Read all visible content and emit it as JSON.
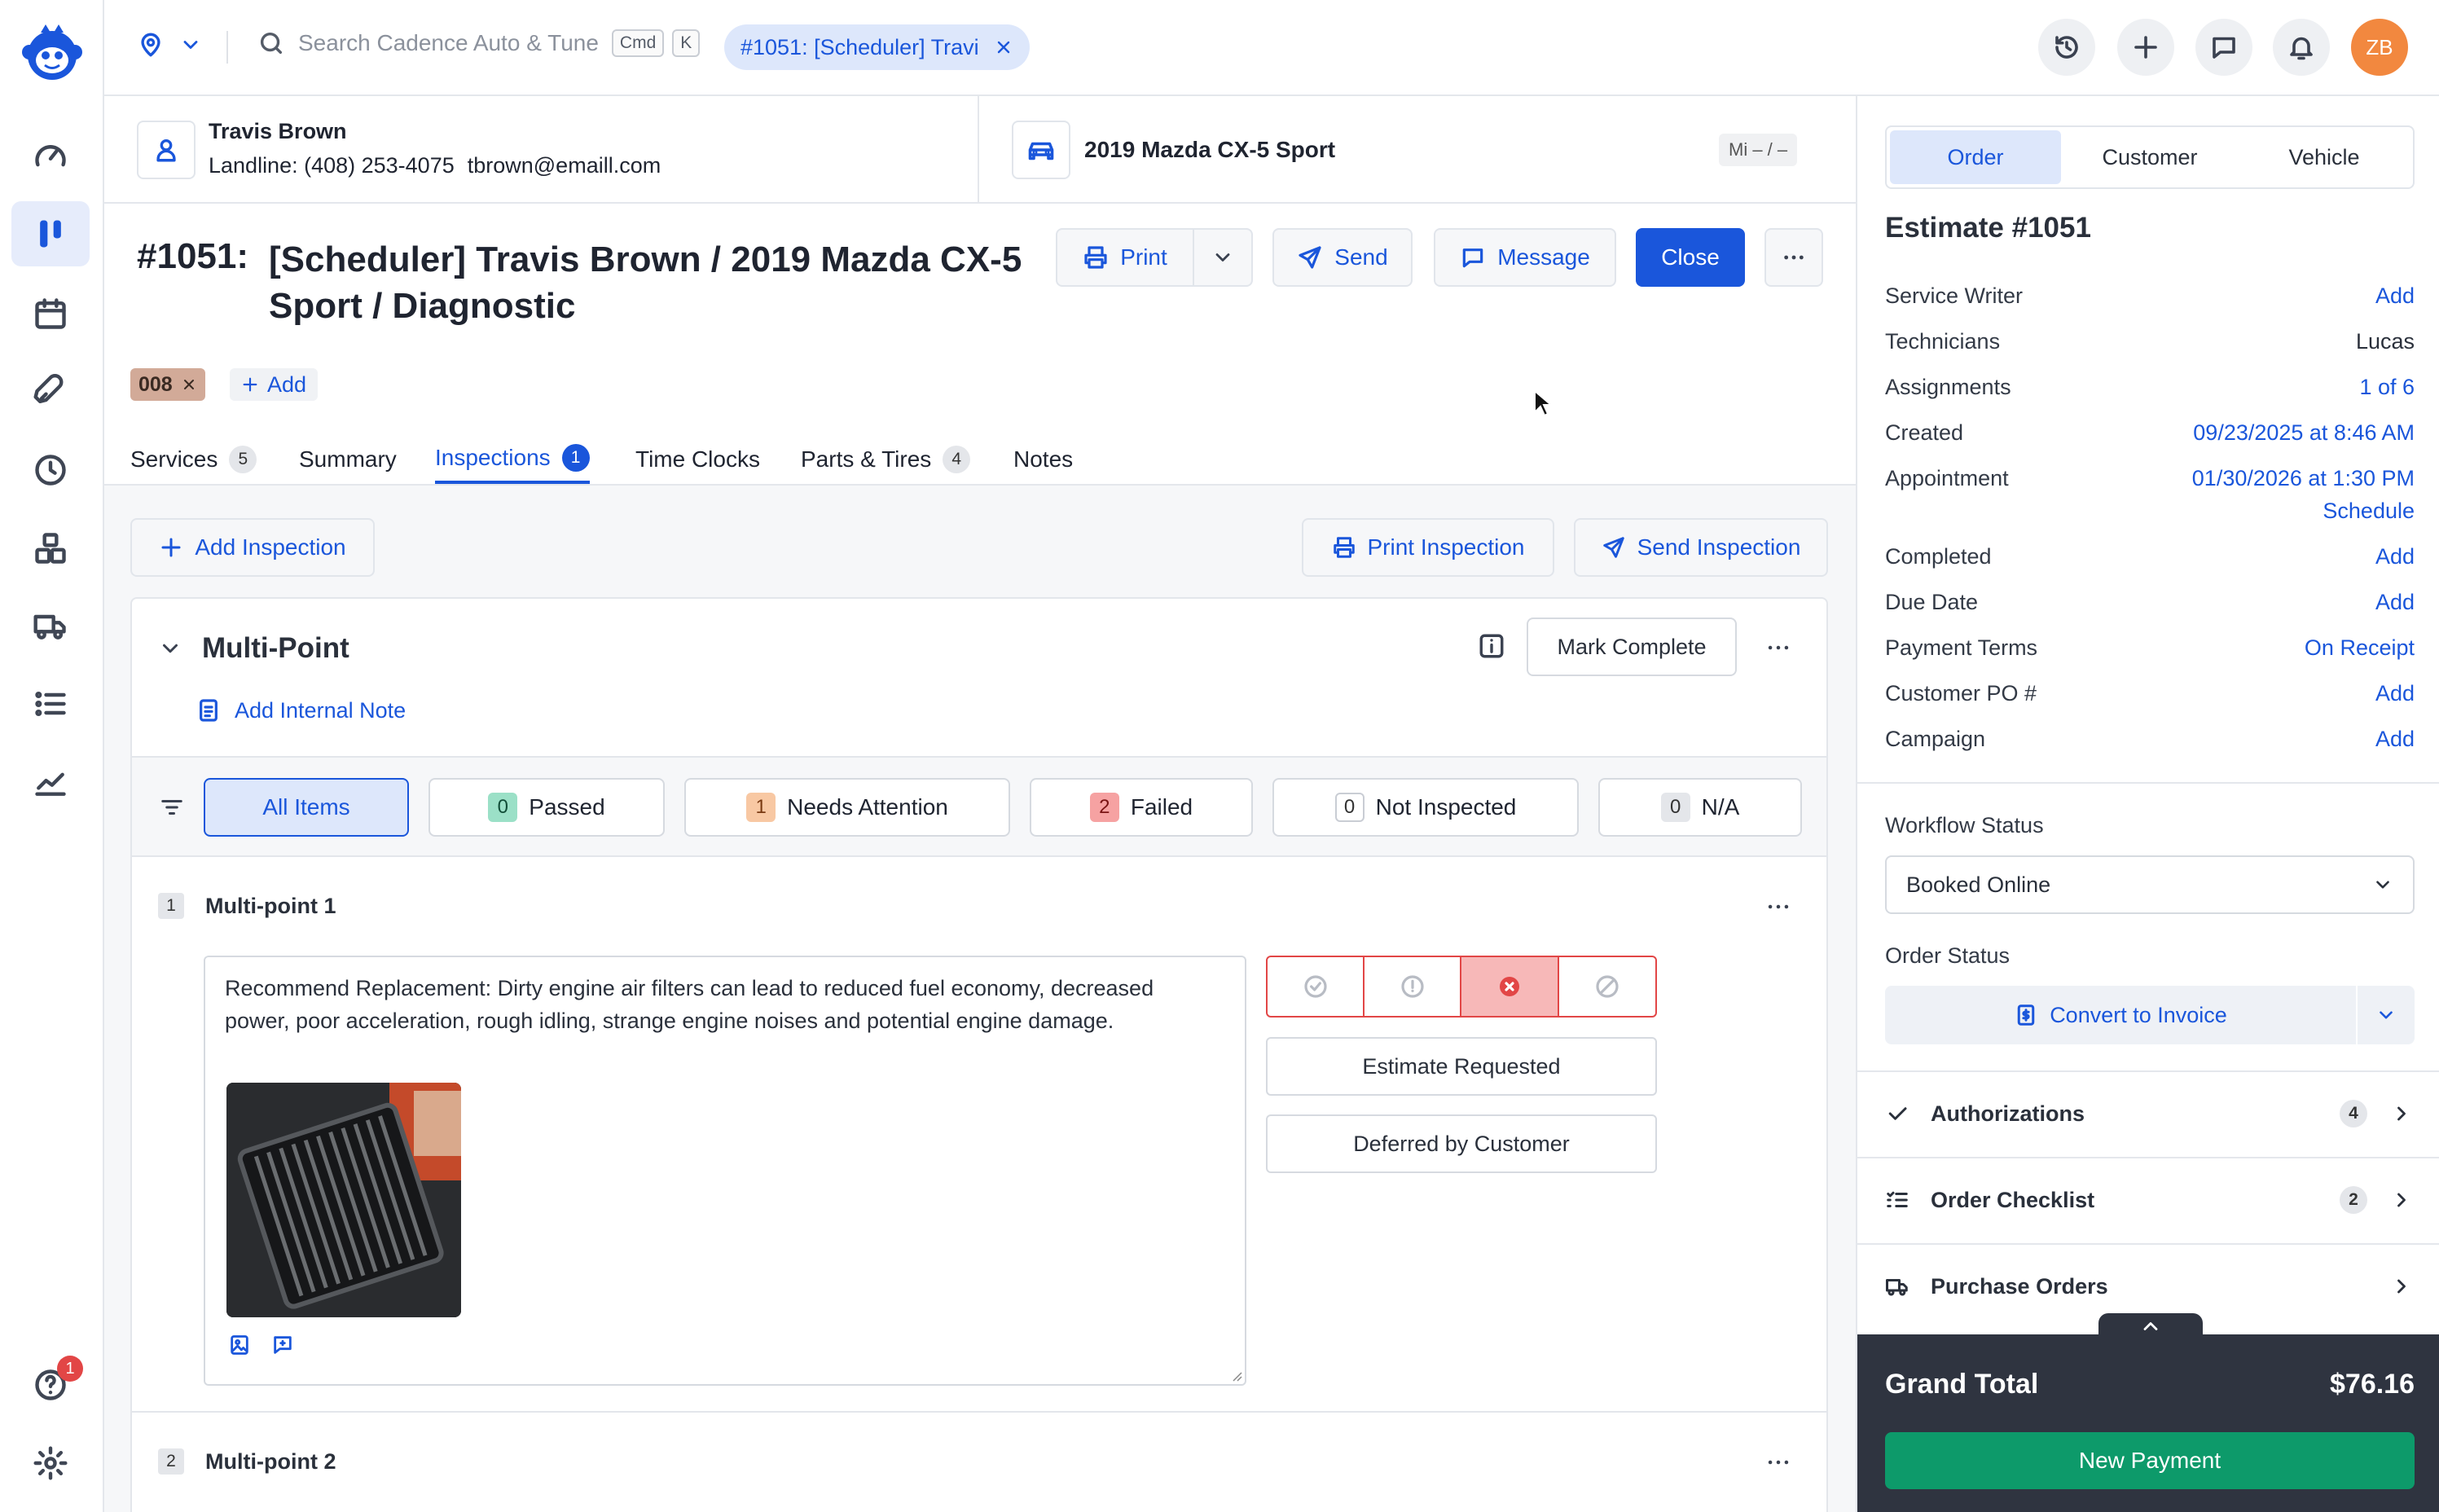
{
  "nav": {
    "help_badge": "1"
  },
  "topbar": {
    "search_placeholder": "Search Cadence Auto & Tune",
    "kbd_cmd": "Cmd",
    "kbd_k": "K",
    "open_tab": "#1051: [Scheduler] Travi",
    "avatar": "ZB"
  },
  "customer": {
    "name": "Travis Brown",
    "phone": "Landline: (408) 253-4075",
    "email": "tbrown@emaill.com"
  },
  "vehicle": {
    "name": "2019 Mazda CX-5 Sport",
    "mileage": "Mi – / –"
  },
  "order": {
    "number": "#1051:",
    "title": "[Scheduler] Travis Brown / 2019 Mazda CX-5 Sport / Diagnostic",
    "tag": "008",
    "add_tag": "Add"
  },
  "actions": {
    "print": "Print",
    "send": "Send",
    "message": "Message",
    "close": "Close"
  },
  "tabs": [
    {
      "label": "Services",
      "count": "5"
    },
    {
      "label": "Summary",
      "count": ""
    },
    {
      "label": "Inspections",
      "count": "1"
    },
    {
      "label": "Time Clocks",
      "count": ""
    },
    {
      "label": "Parts & Tires",
      "count": "4"
    },
    {
      "label": "Notes",
      "count": ""
    }
  ],
  "inspection": {
    "add_inspection": "Add Inspection",
    "print_inspection": "Print Inspection",
    "send_inspection": "Send Inspection",
    "title": "Multi-Point",
    "mark_complete": "Mark Complete",
    "add_internal_note": "Add Internal Note",
    "filters": [
      {
        "label": "All Items",
        "count": ""
      },
      {
        "label": "Passed",
        "count": "0"
      },
      {
        "label": "Needs Attention",
        "count": "1"
      },
      {
        "label": "Failed",
        "count": "2"
      },
      {
        "label": "Not Inspected",
        "count": "0"
      },
      {
        "label": "N/A",
        "count": "0"
      }
    ],
    "items": [
      {
        "index": "1",
        "name": "Multi-point 1",
        "note": "Recommend Replacement: Dirty engine air filters can lead to reduced fuel economy, decreased power, poor acceleration, rough idling, strange engine noises and potential engine damage.",
        "estimate_requested": "Estimate Requested",
        "deferred": "Deferred by Customer",
        "status": "failed"
      },
      {
        "index": "2",
        "name": "Multi-point 2"
      }
    ]
  },
  "panel": {
    "tabs": [
      "Order",
      "Customer",
      "Vehicle"
    ],
    "estimate_title": "Estimate #1051",
    "fields": [
      {
        "key": "Service Writer",
        "value": "Add"
      },
      {
        "key": "Technicians",
        "value": "Lucas"
      },
      {
        "key": "Assignments",
        "value": "1 of 6"
      },
      {
        "key": "Created",
        "value": "09/23/2025 at 8:46 AM"
      },
      {
        "key": "Appointment",
        "value": "01/30/2026 at 1:30 PM",
        "extra": "Schedule"
      },
      {
        "key": "Completed",
        "value": "Add"
      },
      {
        "key": "Due Date",
        "value": "Add"
      },
      {
        "key": "Payment Terms",
        "value": "On Receipt"
      },
      {
        "key": "Customer PO #",
        "value": "Add"
      },
      {
        "key": "Campaign",
        "value": "Add"
      }
    ],
    "workflow_label": "Workflow Status",
    "workflow_value": "Booked Online",
    "order_status_label": "Order Status",
    "convert": "Convert to Invoice",
    "sections": [
      {
        "label": "Authorizations",
        "count": "4"
      },
      {
        "label": "Order Checklist",
        "count": "2"
      },
      {
        "label": "Purchase Orders",
        "count": ""
      }
    ],
    "grand_total_label": "Grand Total",
    "grand_total": "$76.16",
    "new_payment": "New Payment"
  },
  "colors": {
    "accent": "#1a56db",
    "failed": "#e24646",
    "payment": "#0d9a6a",
    "footer": "#2f3440"
  }
}
